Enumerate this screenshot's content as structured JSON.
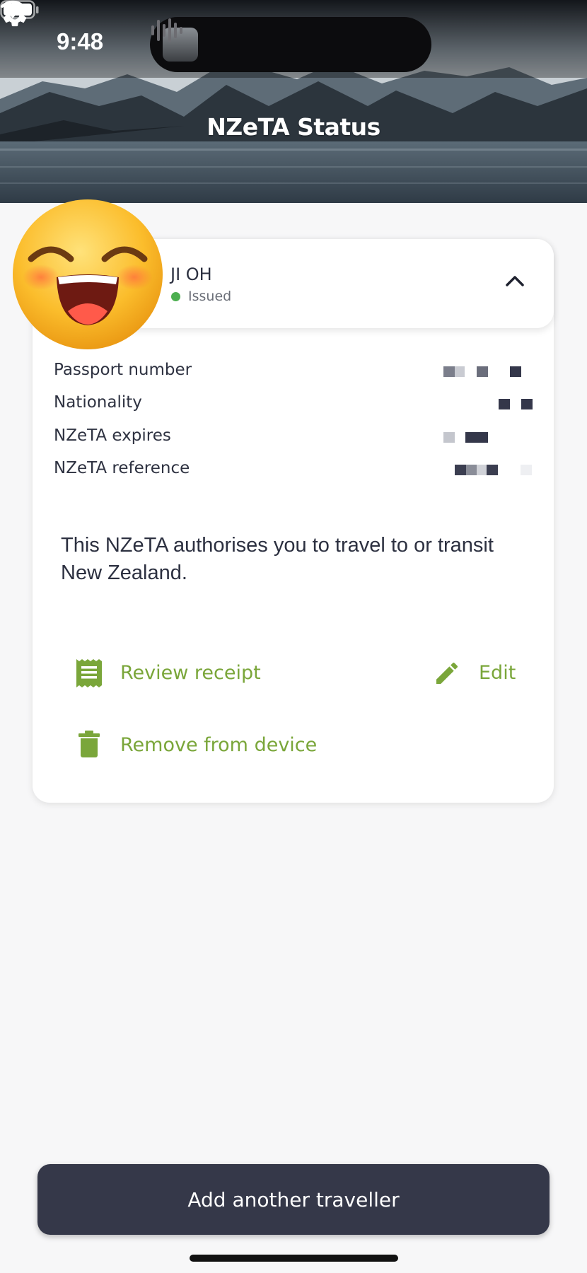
{
  "status_bar": {
    "time": "9:48"
  },
  "header": {
    "title": "NZeTA Status"
  },
  "traveller": {
    "name": "JI OH",
    "status": "Issued"
  },
  "details": [
    {
      "label": "Passport number"
    },
    {
      "label": "Nationality"
    },
    {
      "label": "NZeTA expires"
    },
    {
      "label": "NZeTA reference"
    }
  ],
  "authorisation_text": "This NZeTA authorises you to travel to or transit New Zealand.",
  "actions": {
    "review_receipt": "Review receipt",
    "edit": "Edit",
    "remove": "Remove from device"
  },
  "add_button_label": "Add another traveller",
  "colors": {
    "accent": "#7aa63a",
    "button": "#353849",
    "status_ok": "#4caf50"
  },
  "icons": [
    "gear-icon",
    "chevron-up-icon",
    "receipt-icon",
    "edit-icon",
    "trash-icon",
    "wifi-icon",
    "battery-icon",
    "smiling-emoji-icon"
  ]
}
